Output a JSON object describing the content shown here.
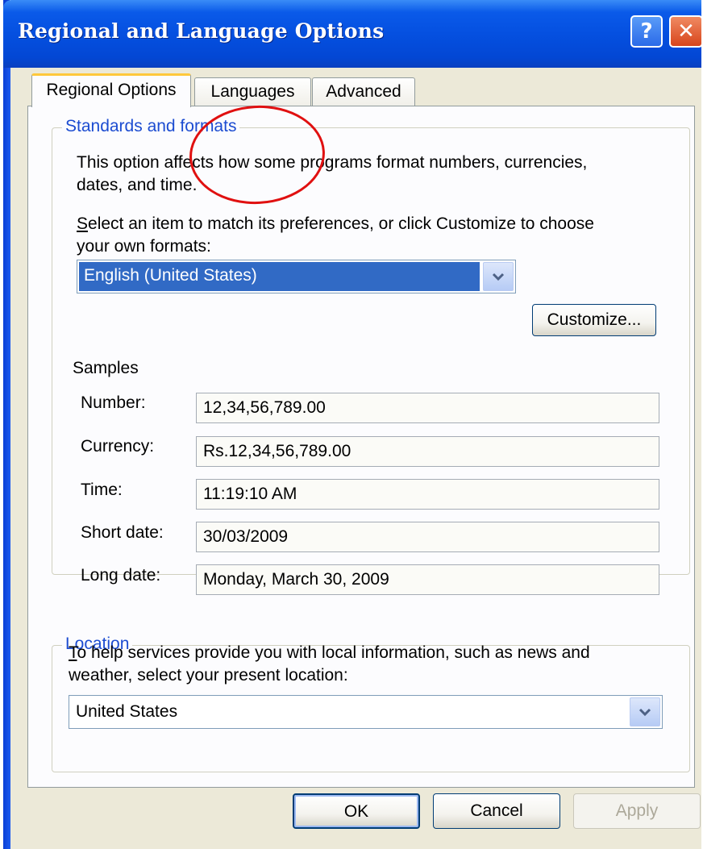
{
  "window": {
    "title": "Regional and Language Options"
  },
  "title_buttons": {
    "help": "?",
    "close": "✕"
  },
  "tabs": [
    {
      "label": "Regional Options",
      "active": true
    },
    {
      "label": "Languages",
      "active": false
    },
    {
      "label": "Advanced",
      "active": false
    }
  ],
  "standards": {
    "legend": "Standards and formats",
    "description_line1": "This option affects how some programs format numbers, currencies,",
    "description_line2": "dates, and time.",
    "prompt_line1": "Select an item to match its preferences, or click Customize to choose",
    "prompt_line2": "your own formats:",
    "selected_format": "English (United States)",
    "customize_label": "Customize..."
  },
  "samples": {
    "heading": "Samples",
    "rows": [
      {
        "label": "Number:",
        "value": "12,34,56,789.00"
      },
      {
        "label": "Currency:",
        "value": "Rs.12,34,56,789.00"
      },
      {
        "label": "Time:",
        "value": "11:19:10 AM"
      },
      {
        "label": "Short date:",
        "value": "30/03/2009"
      },
      {
        "label": "Long date:",
        "value": "Monday, March 30, 2009"
      }
    ]
  },
  "location": {
    "legend": "Location",
    "description_line1": "To help services provide you with local information, such as news and",
    "description_line2": "weather, select your present location:",
    "selected": "United States"
  },
  "buttons": {
    "ok": "OK",
    "cancel": "Cancel",
    "apply": "Apply"
  },
  "colors": {
    "title_bar": "#0550e0",
    "legend_text": "#1c4cd1",
    "selection": "#316ac5",
    "annotation": "#e01010"
  },
  "icons": [
    "help-icon",
    "close-icon",
    "dropdown-arrow-icon"
  ]
}
